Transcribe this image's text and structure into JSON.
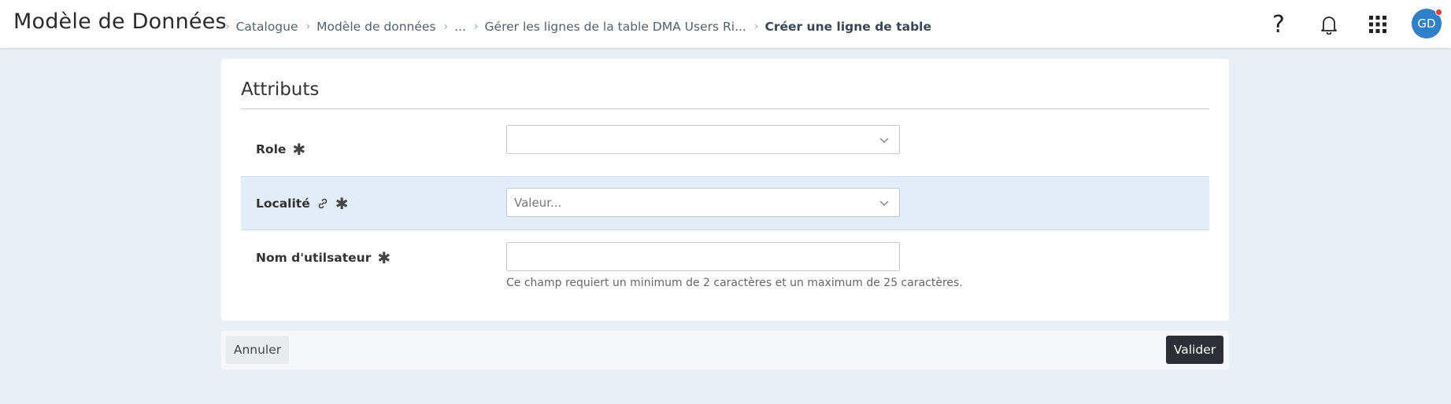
{
  "header": {
    "app_title": "Modèle de Données",
    "breadcrumbs": [
      {
        "label": "Catalogue"
      },
      {
        "label": "Modèle de données"
      },
      {
        "label": "..."
      },
      {
        "label": "Gérer les lignes de la table DMA Users Ri..."
      },
      {
        "label": "Créer une ligne de table"
      }
    ],
    "help_glyph": "?",
    "avatar_initials": "GD",
    "icons": [
      "help-icon",
      "bell-icon",
      "apps-grid-icon"
    ],
    "notification_dot_color": "#e53935",
    "avatar_color": "#2f80c8"
  },
  "form": {
    "section_title": "Attributs",
    "fields": [
      {
        "label": "Role",
        "required_mark": "✱",
        "value": "",
        "placeholder": ""
      },
      {
        "label": "Localité",
        "required_mark": "✱",
        "value": "",
        "placeholder": "Valeur..."
      },
      {
        "label": "Nom d'utilsateur",
        "required_mark": "✱",
        "value": "",
        "placeholder": "",
        "hint": "Ce champ requiert un minimum de 2 caractères et un maximum de 25 caractères."
      }
    ],
    "highlight_row_color": "#e3edf7"
  },
  "actions": {
    "cancel_label": "Annuler",
    "submit_label": "Valider",
    "submit_color": "#2c2f33"
  }
}
